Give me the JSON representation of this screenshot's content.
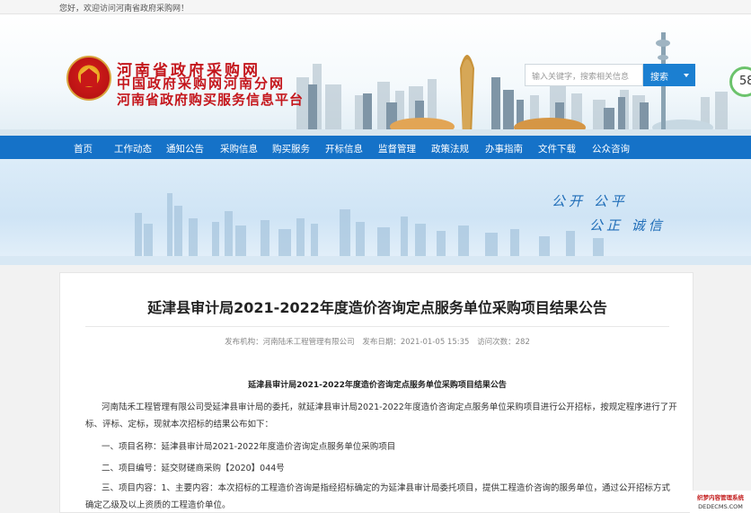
{
  "topbar": {
    "welcome": "您好，欢迎访问河南省政府采购网！"
  },
  "logo": {
    "line1": "河南省政府采购网",
    "line2": "中国政府采购网河南分网",
    "line3": "河南省政府购买服务信息平台"
  },
  "search": {
    "placeholder": "输入关键字，搜索相关信息",
    "button": "搜索"
  },
  "badge": {
    "number": "58"
  },
  "nav": {
    "items": [
      "首页",
      "工作动态",
      "通知公告",
      "采购信息",
      "购买服务",
      "开标信息",
      "监督管理",
      "政策法规",
      "办事指南",
      "文件下载",
      "公众咨询"
    ]
  },
  "banner": {
    "slogan1": "公开  公平",
    "slogan2": "公正  诚信"
  },
  "article": {
    "title": "延津县审计局2021-2022年度造价咨询定点服务单位采购项目结果公告",
    "meta_publisher": "发布机构：河南陆禾工程管理有限公司",
    "meta_date": "发布日期：2021-01-05 15:35",
    "meta_views": "访问次数：282",
    "subtitle": "延津县审计局2021-2022年度造价咨询定点服务单位采购项目结果公告",
    "p1": "河南陆禾工程管理有限公司受延津县审计局的委托，就延津县审计局2021-2022年度造价咨询定点服务单位采购项目进行公开招标，按规定程序进行了开标、评标、定标，现就本次招标的结果公布如下：",
    "p2": "一、项目名称：延津县审计局2021-2022年度造价咨询定点服务单位采购项目",
    "p3": "二、项目编号：延交财磋商采购【2020】044号",
    "p4": "三、项目内容：1、主要内容：本次招标的工程造价咨询是指经招标确定的为延津县审计局委托项目，提供工程造价咨询的服务单位，通过公开招标方式确定乙级及以上资质的工程造价单位。"
  },
  "watermark": {
    "line1": "织梦内容管理系统",
    "line2": "DEDECMS.COM"
  }
}
